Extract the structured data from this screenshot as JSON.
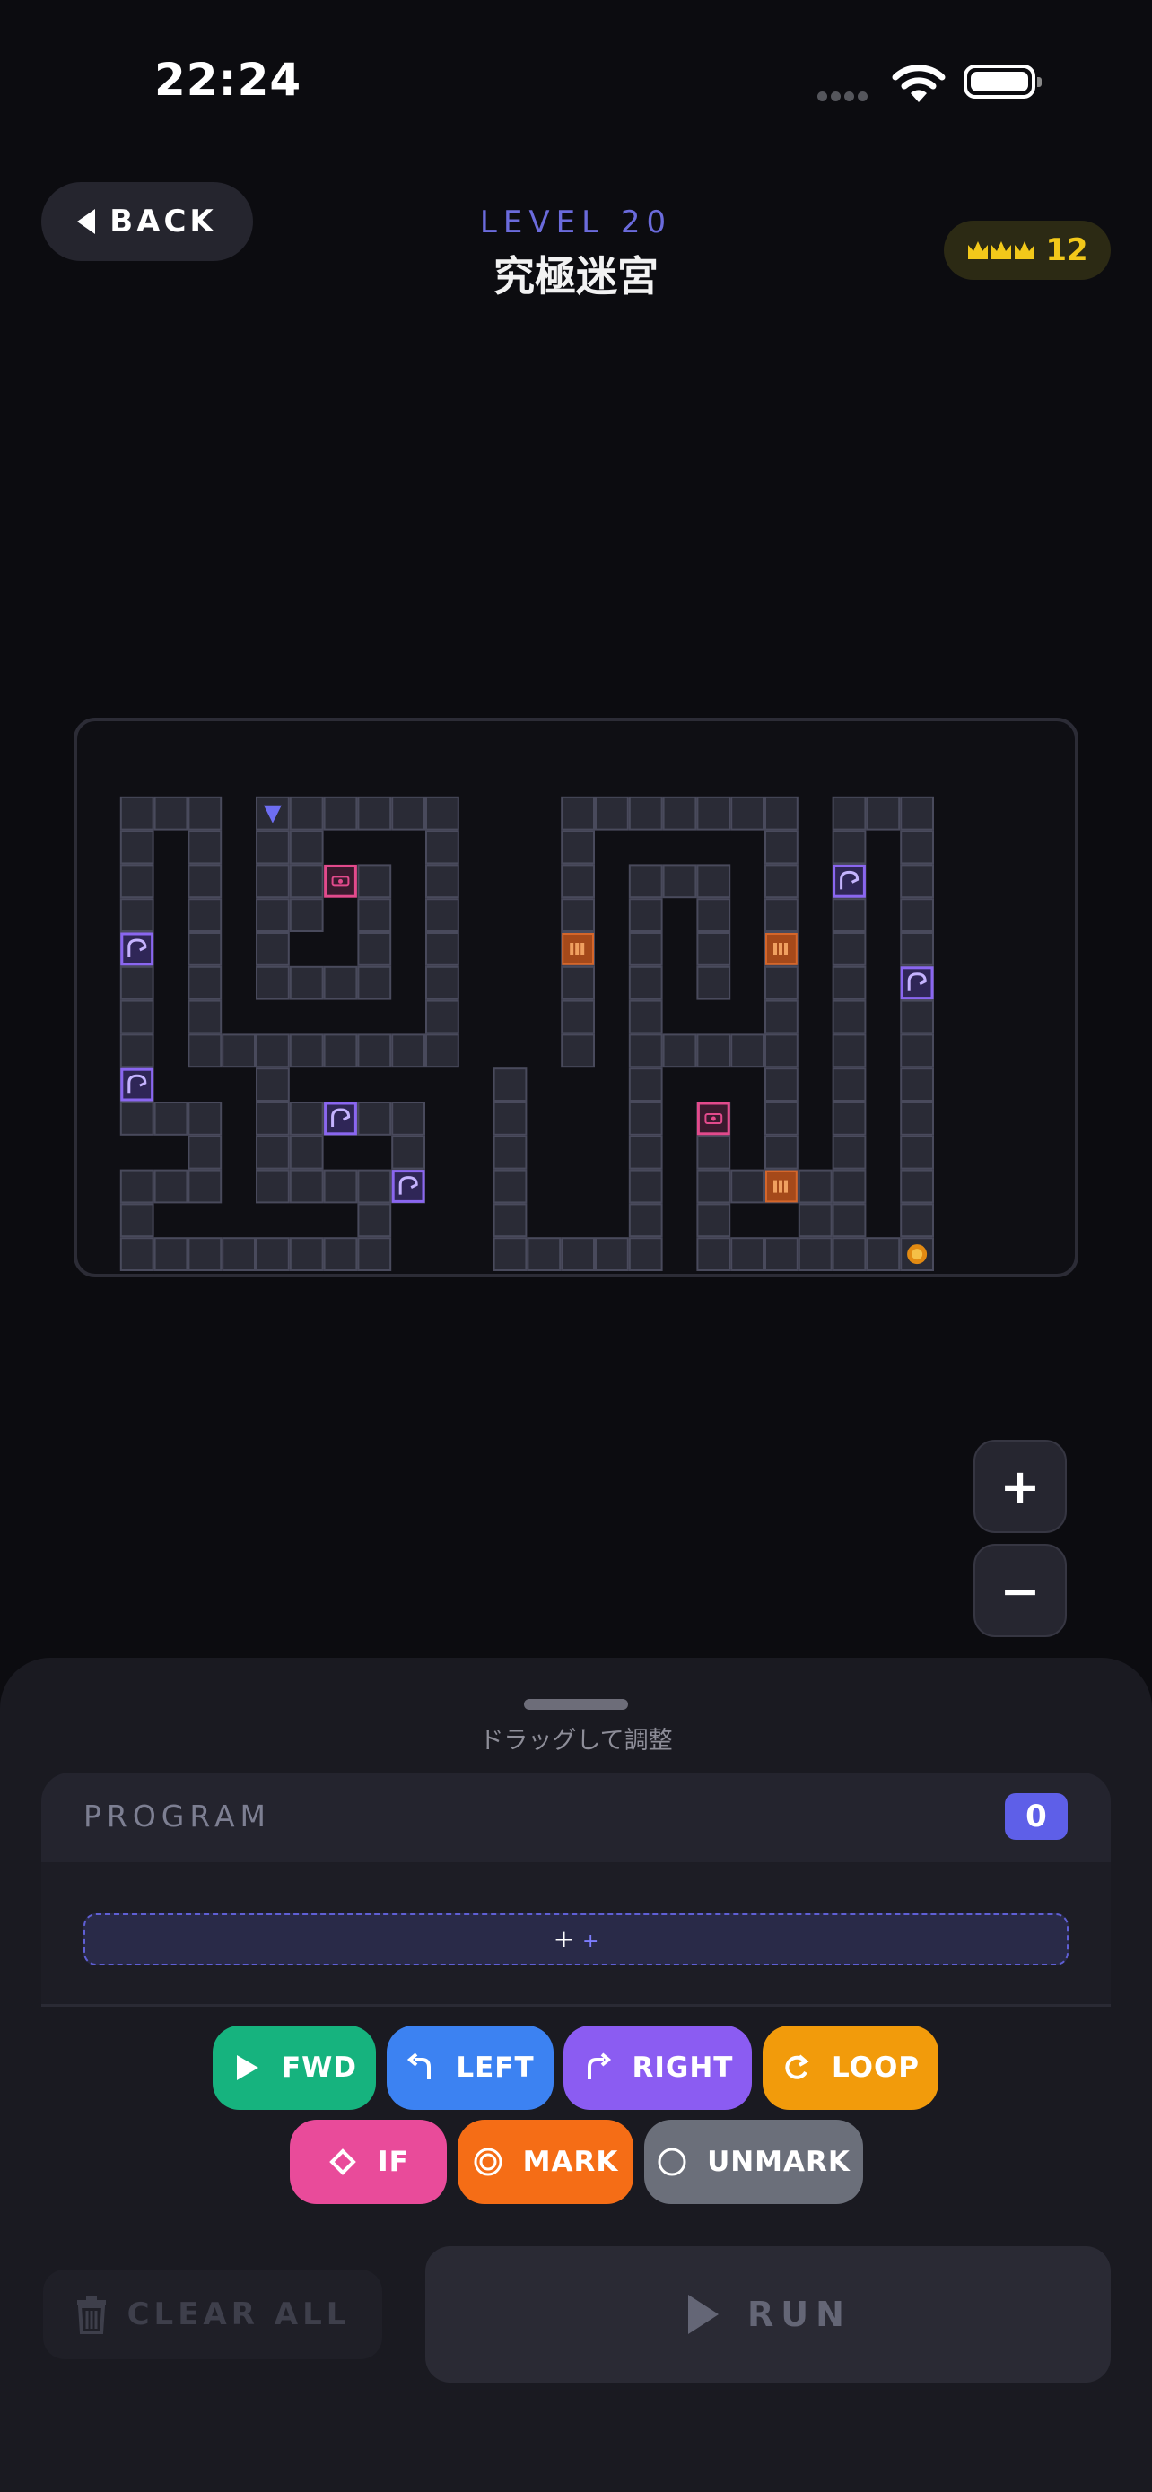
{
  "status_bar": {
    "time": "22:24",
    "icons": [
      "signal-dots-icon",
      "wifi-icon",
      "battery-icon"
    ]
  },
  "header": {
    "back_label": "BACK",
    "level_label": "LEVEL 20",
    "level_title": "究極迷宮",
    "stars_count": "12",
    "accent_color": "#6b6bdc",
    "star_color": "#f2c81a"
  },
  "board": {
    "path_cells": [
      [
        1,
        1
      ],
      [
        2,
        1
      ],
      [
        3,
        1
      ],
      [
        5,
        1
      ],
      [
        6,
        1
      ],
      [
        7,
        1
      ],
      [
        8,
        1
      ],
      [
        9,
        1
      ],
      [
        10,
        1
      ],
      [
        14,
        1
      ],
      [
        15,
        1
      ],
      [
        16,
        1
      ],
      [
        17,
        1
      ],
      [
        18,
        1
      ],
      [
        19,
        1
      ],
      [
        20,
        1
      ],
      [
        22,
        1
      ],
      [
        23,
        1
      ],
      [
        24,
        1
      ],
      [
        1,
        2
      ],
      [
        3,
        2
      ],
      [
        5,
        2
      ],
      [
        6,
        2
      ],
      [
        10,
        2
      ],
      [
        14,
        2
      ],
      [
        20,
        2
      ],
      [
        22,
        2
      ],
      [
        24,
        2
      ],
      [
        1,
        3
      ],
      [
        3,
        3
      ],
      [
        5,
        3
      ],
      [
        6,
        3
      ],
      [
        8,
        3
      ],
      [
        10,
        3
      ],
      [
        14,
        3
      ],
      [
        16,
        3
      ],
      [
        17,
        3
      ],
      [
        18,
        3
      ],
      [
        20,
        3
      ],
      [
        22,
        3
      ],
      [
        24,
        3
      ],
      [
        1,
        4
      ],
      [
        3,
        4
      ],
      [
        5,
        4
      ],
      [
        6,
        4
      ],
      [
        8,
        4
      ],
      [
        10,
        4
      ],
      [
        14,
        4
      ],
      [
        16,
        4
      ],
      [
        18,
        4
      ],
      [
        20,
        4
      ],
      [
        22,
        4
      ],
      [
        24,
        4
      ],
      [
        1,
        5
      ],
      [
        3,
        5
      ],
      [
        5,
        5
      ],
      [
        8,
        5
      ],
      [
        10,
        5
      ],
      [
        14,
        5
      ],
      [
        16,
        5
      ],
      [
        18,
        5
      ],
      [
        20,
        5
      ],
      [
        22,
        5
      ],
      [
        24,
        5
      ],
      [
        1,
        6
      ],
      [
        3,
        6
      ],
      [
        5,
        6
      ],
      [
        6,
        6
      ],
      [
        7,
        6
      ],
      [
        8,
        6
      ],
      [
        10,
        6
      ],
      [
        14,
        6
      ],
      [
        16,
        6
      ],
      [
        18,
        6
      ],
      [
        20,
        6
      ],
      [
        22,
        6
      ],
      [
        24,
        6
      ],
      [
        1,
        7
      ],
      [
        3,
        7
      ],
      [
        10,
        7
      ],
      [
        14,
        7
      ],
      [
        16,
        7
      ],
      [
        20,
        7
      ],
      [
        22,
        7
      ],
      [
        24,
        7
      ],
      [
        1,
        8
      ],
      [
        3,
        8
      ],
      [
        4,
        8
      ],
      [
        5,
        8
      ],
      [
        6,
        8
      ],
      [
        7,
        8
      ],
      [
        8,
        8
      ],
      [
        9,
        8
      ],
      [
        10,
        8
      ],
      [
        14,
        8
      ],
      [
        16,
        8
      ],
      [
        17,
        8
      ],
      [
        18,
        8
      ],
      [
        19,
        8
      ],
      [
        20,
        8
      ],
      [
        22,
        8
      ],
      [
        24,
        8
      ],
      [
        1,
        9
      ],
      [
        5,
        9
      ],
      [
        12,
        9
      ],
      [
        16,
        9
      ],
      [
        20,
        9
      ],
      [
        22,
        9
      ],
      [
        24,
        9
      ],
      [
        1,
        10
      ],
      [
        2,
        10
      ],
      [
        3,
        10
      ],
      [
        5,
        10
      ],
      [
        6,
        10
      ],
      [
        7,
        10
      ],
      [
        8,
        10
      ],
      [
        9,
        10
      ],
      [
        12,
        10
      ],
      [
        16,
        10
      ],
      [
        18,
        10
      ],
      [
        20,
        10
      ],
      [
        22,
        10
      ],
      [
        24,
        10
      ],
      [
        3,
        11
      ],
      [
        5,
        11
      ],
      [
        6,
        11
      ],
      [
        9,
        11
      ],
      [
        12,
        11
      ],
      [
        16,
        11
      ],
      [
        18,
        11
      ],
      [
        20,
        11
      ],
      [
        22,
        11
      ],
      [
        24,
        11
      ],
      [
        1,
        12
      ],
      [
        2,
        12
      ],
      [
        3,
        12
      ],
      [
        5,
        12
      ],
      [
        6,
        12
      ],
      [
        7,
        12
      ],
      [
        8,
        12
      ],
      [
        9,
        12
      ],
      [
        12,
        12
      ],
      [
        16,
        12
      ],
      [
        18,
        12
      ],
      [
        19,
        12
      ],
      [
        20,
        12
      ],
      [
        21,
        12
      ],
      [
        22,
        12
      ],
      [
        24,
        12
      ],
      [
        1,
        13
      ],
      [
        8,
        13
      ],
      [
        12,
        13
      ],
      [
        16,
        13
      ],
      [
        18,
        13
      ],
      [
        21,
        13
      ],
      [
        22,
        13
      ],
      [
        24,
        13
      ],
      [
        1,
        14
      ],
      [
        2,
        14
      ],
      [
        3,
        14
      ],
      [
        4,
        14
      ],
      [
        5,
        14
      ],
      [
        6,
        14
      ],
      [
        7,
        14
      ],
      [
        8,
        14
      ],
      [
        12,
        14
      ],
      [
        13,
        14
      ],
      [
        14,
        14
      ],
      [
        15,
        14
      ],
      [
        16,
        14
      ],
      [
        18,
        14
      ],
      [
        19,
        14
      ],
      [
        20,
        14
      ],
      [
        21,
        14
      ],
      [
        22,
        14
      ],
      [
        23,
        14
      ],
      [
        24,
        14
      ]
    ],
    "start": {
      "cell": [
        5,
        1
      ],
      "direction": "down",
      "icon": "robot-start-arrow-icon"
    },
    "goal": {
      "cell": [
        24,
        14
      ],
      "icon": "goal-coin-icon"
    },
    "items": [
      {
        "type": "teleport",
        "cell": [
          1,
          5
        ],
        "icon": "teleport-portal-icon"
      },
      {
        "type": "teleport",
        "cell": [
          1,
          9
        ],
        "icon": "teleport-portal-icon"
      },
      {
        "type": "teleport",
        "cell": [
          7,
          10
        ],
        "icon": "teleport-portal-icon"
      },
      {
        "type": "teleport",
        "cell": [
          9,
          12
        ],
        "icon": "teleport-portal-icon"
      },
      {
        "type": "teleport",
        "cell": [
          22,
          3
        ],
        "icon": "teleport-portal-icon"
      },
      {
        "type": "teleport",
        "cell": [
          24,
          6
        ],
        "icon": "teleport-portal-icon"
      },
      {
        "type": "switch",
        "cell": [
          7,
          3
        ],
        "icon": "switch-key-icon"
      },
      {
        "type": "switch",
        "cell": [
          18,
          10
        ],
        "icon": "switch-key-icon"
      },
      {
        "type": "gate",
        "cell": [
          14,
          5
        ],
        "icon": "gate-bars-icon"
      },
      {
        "type": "gate",
        "cell": [
          20,
          5
        ],
        "icon": "gate-bars-icon"
      },
      {
        "type": "gate",
        "cell": [
          20,
          12
        ],
        "icon": "gate-bars-icon"
      }
    ]
  },
  "zoom": {
    "in_label": "+",
    "out_label": "−"
  },
  "sheet": {
    "drag_hint": "ドラッグして調整",
    "program_title": "PROGRAM",
    "program_count": "0",
    "drop_slot_label": "+",
    "drop_slot_sub": "+"
  },
  "commands": [
    {
      "id": "fwd",
      "label": "FWD",
      "color": "#16b37e",
      "icon": "play-icon"
    },
    {
      "id": "left",
      "label": "LEFT",
      "color": "#3c82f2",
      "icon": "turn-left-icon"
    },
    {
      "id": "right",
      "label": "RIGHT",
      "color": "#8b5cf2",
      "icon": "turn-right-icon"
    },
    {
      "id": "loop",
      "label": "LOOP",
      "color": "#f29b0b",
      "icon": "loop-icon"
    },
    {
      "id": "if",
      "label": "IF",
      "color": "#e94b9a",
      "icon": "diamond-icon"
    },
    {
      "id": "mark",
      "label": "MARK",
      "color": "#f56d16",
      "icon": "target-icon"
    },
    {
      "id": "unmark",
      "label": "UNMARK",
      "color": "#6b6f7a",
      "icon": "circle-icon"
    }
  ],
  "actions": {
    "clear_label": "CLEAR ALL",
    "run_label": "RUN"
  }
}
